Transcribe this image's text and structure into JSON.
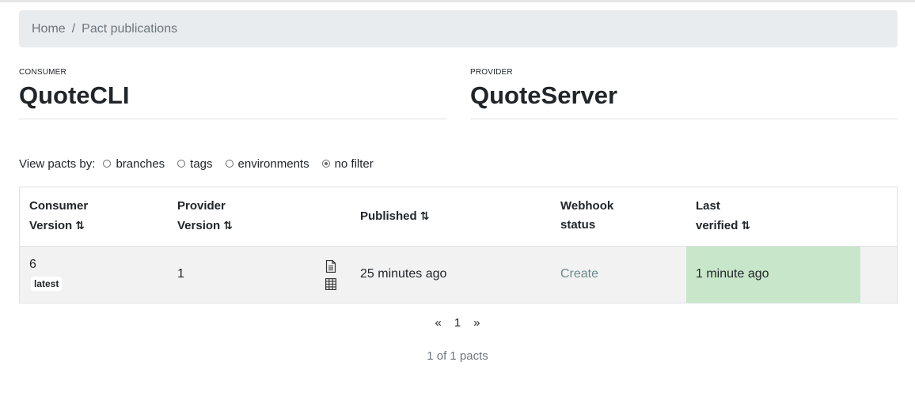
{
  "breadcrumb": {
    "home": "Home",
    "separator": "/",
    "current": "Pact publications"
  },
  "consumer": {
    "role": "CONSUMER",
    "name": "QuoteCLI"
  },
  "provider": {
    "role": "PROVIDER",
    "name": "QuoteServer"
  },
  "filter": {
    "label": "View pacts by:",
    "options": [
      "branches",
      "tags",
      "environments",
      "no filter"
    ],
    "selected": "no filter"
  },
  "table": {
    "headers": {
      "consumer_version": [
        "Consumer",
        "Version"
      ],
      "provider_version": [
        "Provider",
        "Version"
      ],
      "published": "Published",
      "webhook_status": [
        "Webhook",
        "status"
      ],
      "last_verified": [
        "Last",
        "verified"
      ],
      "sort_glyph": "⇅"
    },
    "rows": [
      {
        "consumer_version": "6",
        "badge": "latest",
        "provider_version": "1",
        "published": "25 minutes ago",
        "webhook_status": "Create",
        "last_verified": "1 minute ago",
        "verified_color": "#c8e6c9"
      }
    ]
  },
  "pagination": {
    "prev": "«",
    "page": "1",
    "next": "»"
  },
  "count_text": "1 of 1 pacts"
}
